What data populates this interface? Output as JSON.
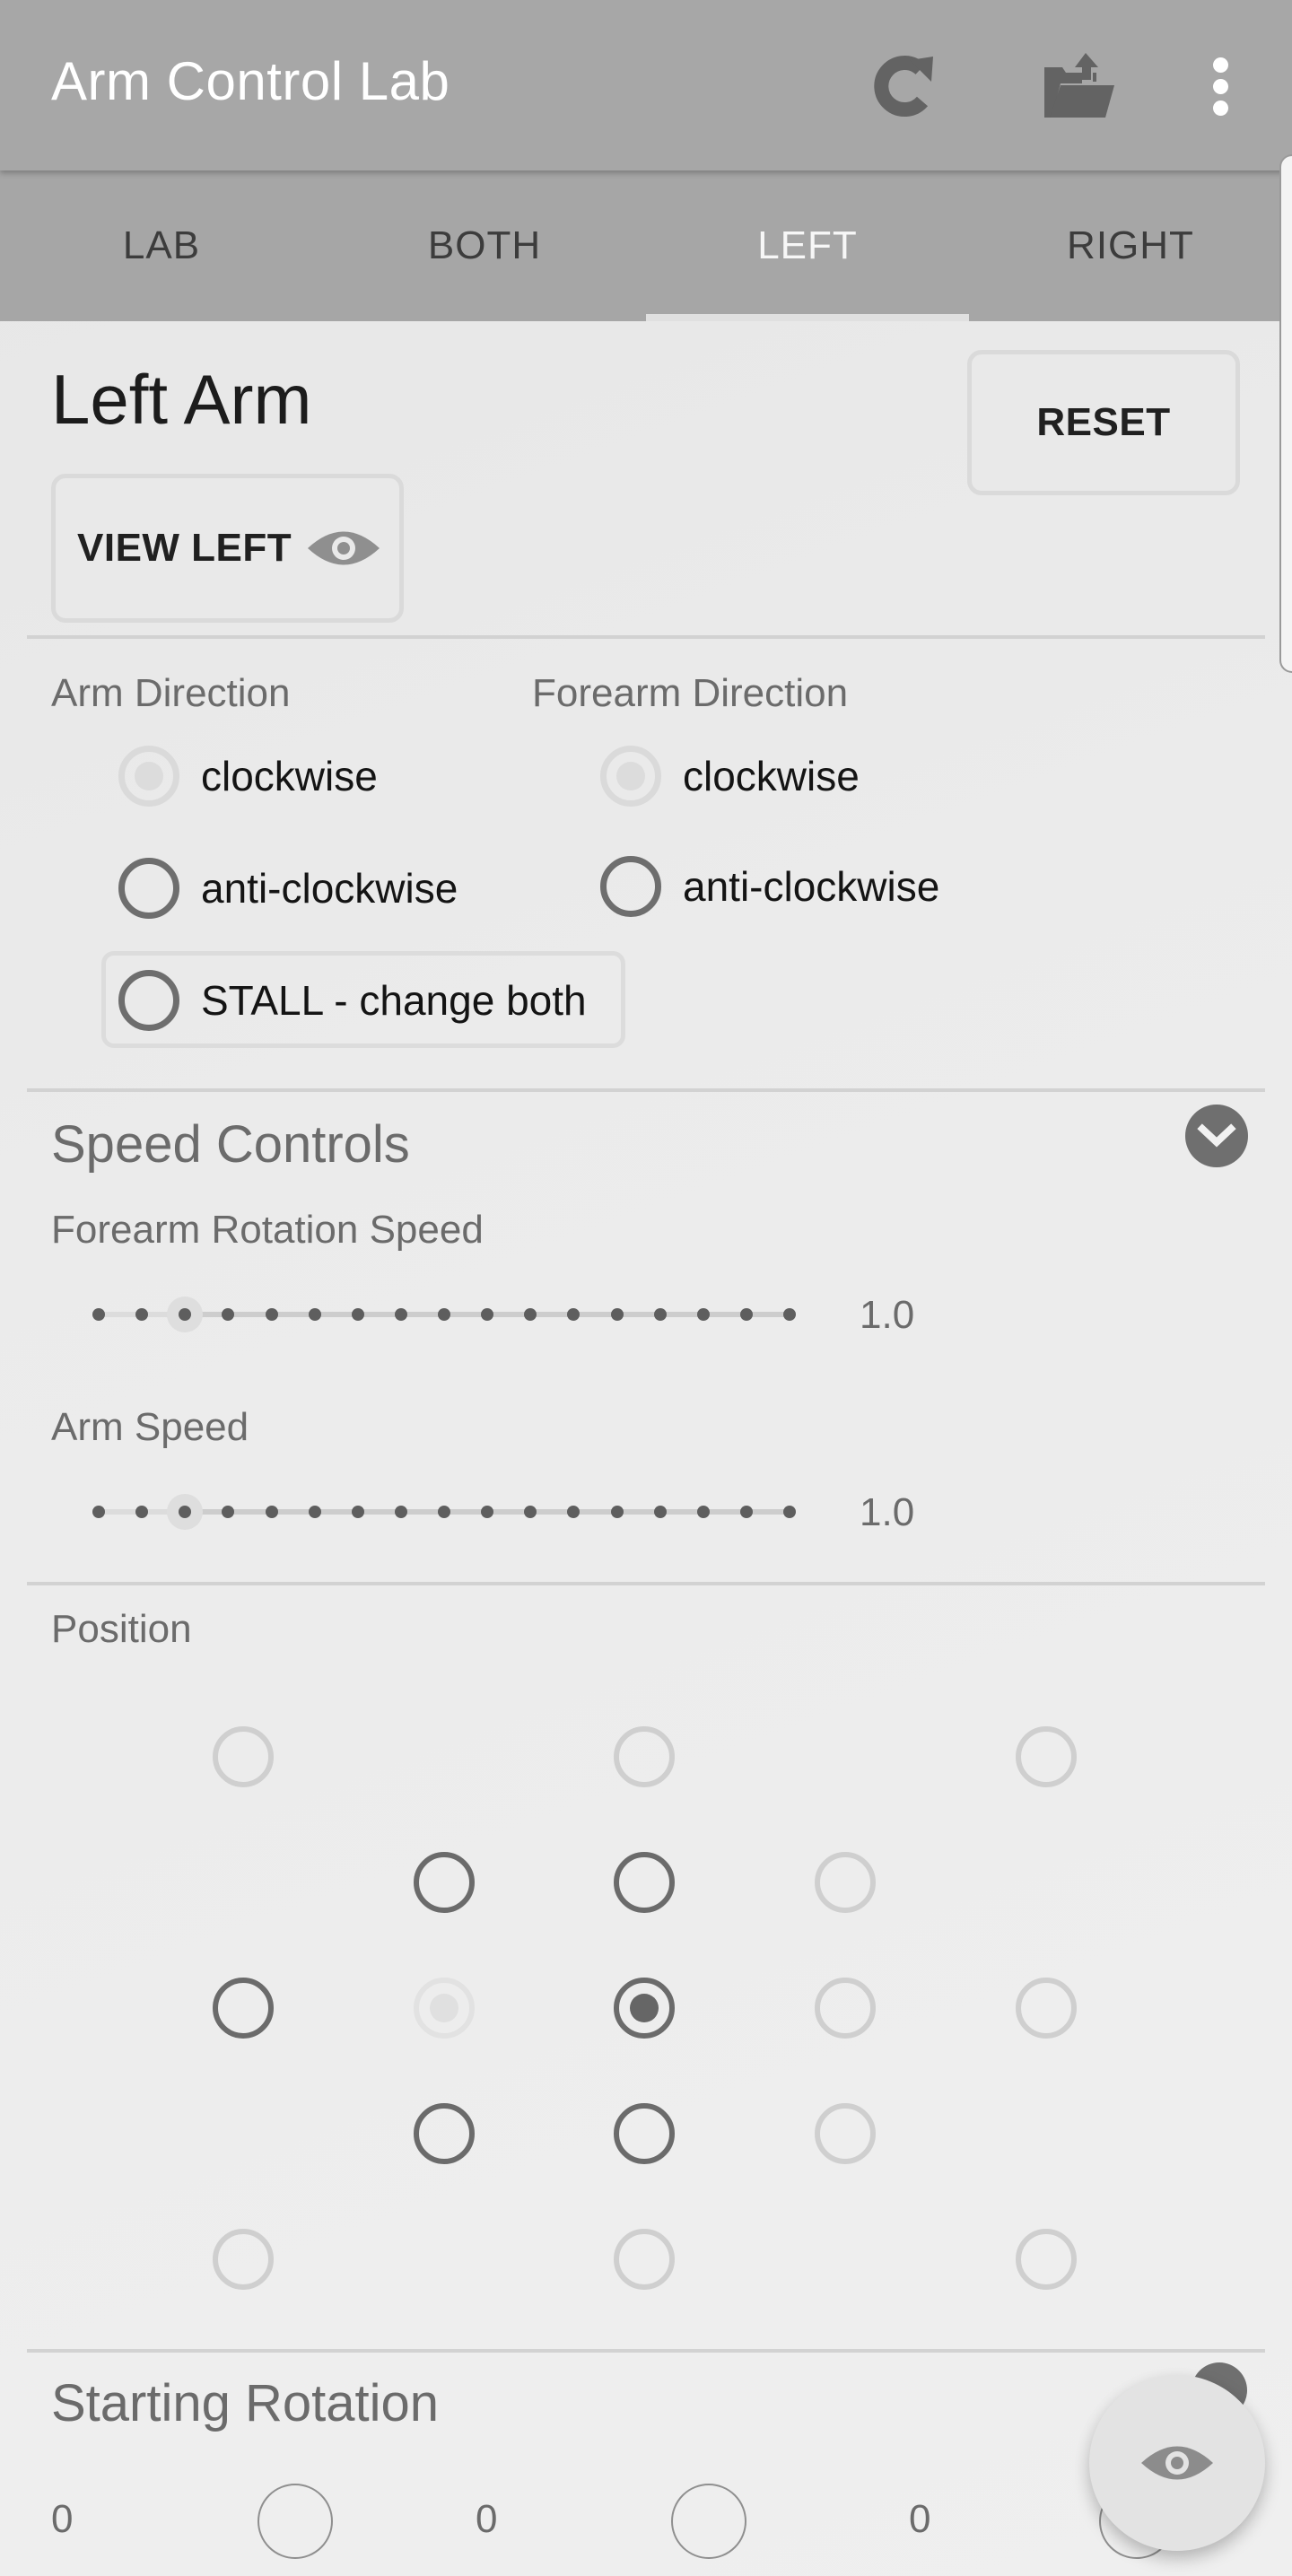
{
  "app": {
    "title": "Arm Control Lab",
    "actions": [
      {
        "name": "refresh",
        "icon": "refresh-icon"
      },
      {
        "name": "export",
        "icon": "folder-upload-icon"
      },
      {
        "name": "more",
        "icon": "more-vert-icon"
      }
    ]
  },
  "tabs": [
    {
      "label": "LAB",
      "active": false
    },
    {
      "label": "BOTH",
      "active": false
    },
    {
      "label": "LEFT",
      "active": true
    },
    {
      "label": "RIGHT",
      "active": false
    }
  ],
  "panel": {
    "title": "Left Arm",
    "reset_label": "RESET",
    "view_label": "VIEW LEFT",
    "view_icon": "eye-icon"
  },
  "direction": {
    "arm_label": "Arm Direction",
    "forearm_label": "Forearm Direction",
    "arm_options": [
      {
        "label": "clockwise",
        "checked": true,
        "disabled": true
      },
      {
        "label": "anti-clockwise",
        "checked": false,
        "disabled": false
      }
    ],
    "forearm_options": [
      {
        "label": "clockwise",
        "checked": true,
        "disabled": true
      },
      {
        "label": "anti-clockwise",
        "checked": false,
        "disabled": false
      }
    ],
    "stall_label": "STALL - change both"
  },
  "speed": {
    "title": "Speed Controls",
    "collapse_icon": "chevron-down-icon",
    "sliders": [
      {
        "label": "Forearm Rotation Speed",
        "value_text": "1.0",
        "steps": 17,
        "position_index": 2
      },
      {
        "label": "Arm Speed",
        "value_text": "1.0",
        "steps": 17,
        "position_index": 2
      }
    ]
  },
  "position": {
    "title": "Position",
    "grid": [
      [
        {
          "state": "dim"
        },
        null,
        {
          "state": "dim"
        },
        null,
        {
          "state": "dim"
        }
      ],
      [
        null,
        {
          "state": "active"
        },
        {
          "state": "active"
        },
        {
          "state": "dim"
        },
        null
      ],
      [
        {
          "state": "active"
        },
        {
          "state": "faint",
          "checked": true
        },
        {
          "state": "active",
          "checked": true
        },
        {
          "state": "dim"
        },
        {
          "state": "dim"
        }
      ],
      [
        null,
        {
          "state": "active"
        },
        {
          "state": "active"
        },
        {
          "state": "dim"
        },
        null
      ],
      [
        {
          "state": "dim"
        },
        null,
        {
          "state": "dim"
        },
        null,
        {
          "state": "dim"
        }
      ]
    ]
  },
  "rotation": {
    "title": "Starting Rotation",
    "values": [
      "0",
      "0",
      "0"
    ]
  },
  "fab": {
    "icon": "eye-icon"
  }
}
